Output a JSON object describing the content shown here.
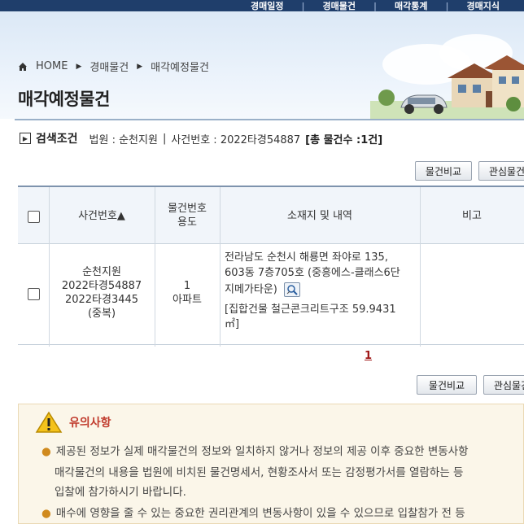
{
  "topnav": {
    "items": [
      "경매일정",
      "경매물건",
      "매각통계",
      "경매지식"
    ]
  },
  "breadcrumb": {
    "home": "HOME",
    "level1": "경매물건",
    "level2": "매각예정물건"
  },
  "page_title": "매각예정물건",
  "search": {
    "label": "검색조건",
    "court_label": "법원 : 순천지원",
    "divider": "|",
    "case_label": "사건번호 : 2022타경54887",
    "total": "[총 물건수 :1건]"
  },
  "buttons": {
    "compare": "물건비교",
    "interest": "관심물건"
  },
  "table": {
    "headers": {
      "case_no": "사건번호▲",
      "item_no": "물건번호",
      "usage": "용도",
      "location": "소재지 및 내역",
      "note": "비고"
    },
    "rows": [
      {
        "court": "순천지원",
        "case1": "2022타경54887",
        "case2": "2022타경3445",
        "dup": "(중복)",
        "item_no": "1",
        "usage": "아파트",
        "loc_line1": "전라남도 순천시 해룡면 좌야로 135,",
        "loc_line2": "603동 7층705호 (중흥에스-클래스6단",
        "loc_line3": "지메가타운)",
        "detail_line1": "[집합건물 철근콘크리트구조 59.9431",
        "detail_line2": "㎡]",
        "note": ""
      }
    ]
  },
  "pager": {
    "current": "1"
  },
  "notice": {
    "title": "유의사항",
    "lines": [
      "제공된 정보가 실제 매각물건의 정보와 일치하지 않거나 정보의 제공 이후 중요한 변동사항",
      "매각물건의 내용을 법원에 비치된 물건명세서, 현황조사서 또는 감정평가서를 열람하는 등",
      "입찰에 참가하시기 바랍니다.",
      "매수에 영향을 줄 수 있는 중요한 권리관계의 변동사항이 있을 수 있으므로 입찰참가 전 등"
    ]
  },
  "colors": {
    "nav": "#1f3e6b",
    "accent_red": "#c0392b",
    "header_bg": "#f1f5fa"
  }
}
